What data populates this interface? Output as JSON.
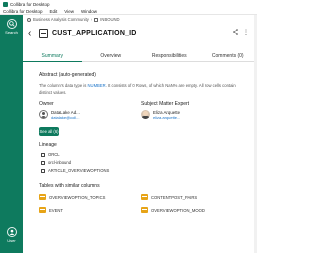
{
  "window": {
    "title": "Collibra for Desktop",
    "menu": [
      "Collibra for Desktop",
      "Edit",
      "View",
      "Window"
    ]
  },
  "nav": {
    "search_label": "Search",
    "user_label": "User"
  },
  "breadcrumb": [
    "Business Analysis Community",
    "INBOUND"
  ],
  "asset": {
    "title": "CUST_APPLICATION_ID"
  },
  "tabs": [
    "Summary",
    "Overview",
    "Responsibilities",
    "Comments (0)"
  ],
  "abstract": {
    "heading": "Abstract (auto-generated)",
    "text_1": "The column's data type is ",
    "text_type": "NUMBER",
    "text_2": ". It consists of 0 Rows, of which NaN% are empty. All row cells contain distinct values."
  },
  "owner": {
    "heading": "Owner",
    "name": "DataLake Ad...",
    "email": "datalake@coll..."
  },
  "sme": {
    "heading": "Subject Matter Expert",
    "name": "Eliza Arquette",
    "email": "eliza.arquette..."
  },
  "see_all": "See all (6)",
  "lineage": {
    "heading": "Lineage",
    "items": [
      "ORCL",
      "orcl-inbound",
      "ARTICLE_OVERVIEWOPTIONS"
    ]
  },
  "similar": {
    "heading": "Tables with similar columns",
    "items": [
      "OVERVIEWOPTION_TOPICS",
      "CONTENTPOST_PAIRS",
      "EVENT",
      "OVERVIEWOPTION_MOOD"
    ]
  },
  "colors": {
    "accent": "#0e7a5e",
    "link": "#1a73c8",
    "table_icon": "#e7a417"
  }
}
